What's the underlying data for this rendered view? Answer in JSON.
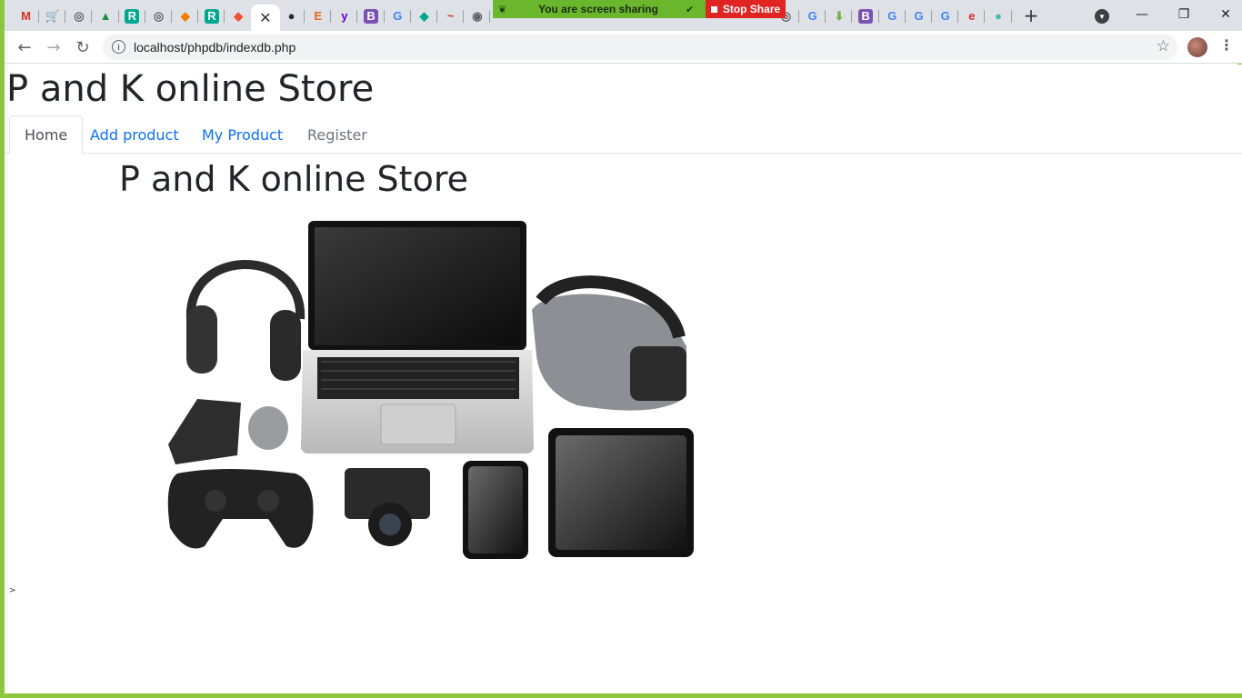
{
  "browser": {
    "tabs": [
      {
        "icon": "gmail-icon",
        "glyph": "M",
        "color": "#d93025"
      },
      {
        "icon": "cart-icon",
        "glyph": "🛒",
        "color": "#5f6368"
      },
      {
        "icon": "globe-icon",
        "glyph": "◎",
        "color": "#5f6368"
      },
      {
        "icon": "drive-icon",
        "glyph": "▲",
        "color": "#1e8e3e"
      },
      {
        "icon": "researchgate-icon",
        "glyph": "R",
        "color": "#00a88f"
      },
      {
        "icon": "globe-icon",
        "glyph": "◎",
        "color": "#5f6368"
      },
      {
        "icon": "shield-icon",
        "glyph": "◆",
        "color": "#f57c00"
      },
      {
        "icon": "researchgate-icon",
        "glyph": "R",
        "color": "#00a88f"
      },
      {
        "icon": "git-icon",
        "glyph": "◆",
        "color": "#f05032"
      },
      {
        "icon": "close-icon",
        "glyph": "✕",
        "color": "#333333",
        "active": true
      },
      {
        "icon": "github-icon",
        "glyph": "●",
        "color": "#24292e"
      },
      {
        "icon": "etsy-icon",
        "glyph": "E",
        "color": "#f1641e"
      },
      {
        "icon": "yahoo-icon",
        "glyph": "y",
        "color": "#6001d2"
      },
      {
        "icon": "bootstrap-icon",
        "glyph": "B",
        "color": "#7952b3"
      },
      {
        "icon": "google-icon",
        "glyph": "G",
        "color": "#4285f4"
      },
      {
        "icon": "diamond-icon",
        "glyph": "◆",
        "color": "#00a88f"
      },
      {
        "icon": "swirl-icon",
        "glyph": "~",
        "color": "#d93025"
      },
      {
        "icon": "camera-icon",
        "glyph": "◉",
        "color": "#5f6368"
      },
      {
        "icon": "globe-icon",
        "glyph": "◎",
        "color": "#5f6368"
      },
      {
        "icon": "google-icon",
        "glyph": "G",
        "color": "#4285f4"
      },
      {
        "icon": "download-icon",
        "glyph": "⬇",
        "color": "#7cb342"
      },
      {
        "icon": "bootstrap-icon",
        "glyph": "B",
        "color": "#7952b3"
      },
      {
        "icon": "google-icon",
        "glyph": "G",
        "color": "#4285f4"
      },
      {
        "icon": "google-icon",
        "glyph": "G",
        "color": "#4285f4"
      },
      {
        "icon": "google-icon",
        "glyph": "G",
        "color": "#4285f4"
      },
      {
        "icon": "e-icon",
        "glyph": "e",
        "color": "#d93025"
      },
      {
        "icon": "earth-icon",
        "glyph": "●",
        "color": "#4db6ac"
      }
    ],
    "new_tab_glyph": "+",
    "url": "localhost/phpdb/indexdb.php",
    "share_message": "You are screen sharing",
    "stop_share_label": "Stop Share",
    "window_controls": {
      "minimize": "—",
      "restore": "❐",
      "close": "✕"
    }
  },
  "page": {
    "store_title": "P and K online Store",
    "nav_tabs": [
      {
        "label": "Home",
        "state": "active"
      },
      {
        "label": "Add product",
        "state": "link"
      },
      {
        "label": "My Product",
        "state": "link"
      },
      {
        "label": "Register",
        "state": "muted"
      }
    ],
    "hero_title": "P and K online Store",
    "stray_text": ">"
  }
}
